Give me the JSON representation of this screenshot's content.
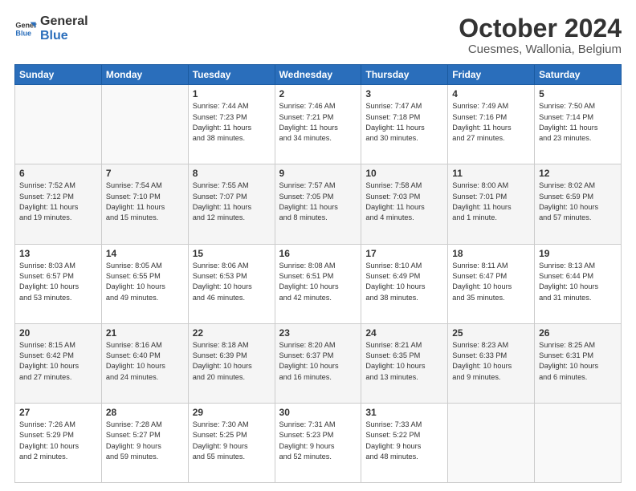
{
  "logo": {
    "line1": "General",
    "line2": "Blue"
  },
  "title": "October 2024",
  "location": "Cuesmes, Wallonia, Belgium",
  "days_of_week": [
    "Sunday",
    "Monday",
    "Tuesday",
    "Wednesday",
    "Thursday",
    "Friday",
    "Saturday"
  ],
  "weeks": [
    {
      "row_class": "row-odd",
      "days": [
        {
          "num": "",
          "detail": "",
          "empty": true
        },
        {
          "num": "",
          "detail": "",
          "empty": true
        },
        {
          "num": "1",
          "detail": "Sunrise: 7:44 AM\nSunset: 7:23 PM\nDaylight: 11 hours\nand 38 minutes.",
          "empty": false
        },
        {
          "num": "2",
          "detail": "Sunrise: 7:46 AM\nSunset: 7:21 PM\nDaylight: 11 hours\nand 34 minutes.",
          "empty": false
        },
        {
          "num": "3",
          "detail": "Sunrise: 7:47 AM\nSunset: 7:18 PM\nDaylight: 11 hours\nand 30 minutes.",
          "empty": false
        },
        {
          "num": "4",
          "detail": "Sunrise: 7:49 AM\nSunset: 7:16 PM\nDaylight: 11 hours\nand 27 minutes.",
          "empty": false
        },
        {
          "num": "5",
          "detail": "Sunrise: 7:50 AM\nSunset: 7:14 PM\nDaylight: 11 hours\nand 23 minutes.",
          "empty": false
        }
      ]
    },
    {
      "row_class": "row-even",
      "days": [
        {
          "num": "6",
          "detail": "Sunrise: 7:52 AM\nSunset: 7:12 PM\nDaylight: 11 hours\nand 19 minutes.",
          "empty": false
        },
        {
          "num": "7",
          "detail": "Sunrise: 7:54 AM\nSunset: 7:10 PM\nDaylight: 11 hours\nand 15 minutes.",
          "empty": false
        },
        {
          "num": "8",
          "detail": "Sunrise: 7:55 AM\nSunset: 7:07 PM\nDaylight: 11 hours\nand 12 minutes.",
          "empty": false
        },
        {
          "num": "9",
          "detail": "Sunrise: 7:57 AM\nSunset: 7:05 PM\nDaylight: 11 hours\nand 8 minutes.",
          "empty": false
        },
        {
          "num": "10",
          "detail": "Sunrise: 7:58 AM\nSunset: 7:03 PM\nDaylight: 11 hours\nand 4 minutes.",
          "empty": false
        },
        {
          "num": "11",
          "detail": "Sunrise: 8:00 AM\nSunset: 7:01 PM\nDaylight: 11 hours\nand 1 minute.",
          "empty": false
        },
        {
          "num": "12",
          "detail": "Sunrise: 8:02 AM\nSunset: 6:59 PM\nDaylight: 10 hours\nand 57 minutes.",
          "empty": false
        }
      ]
    },
    {
      "row_class": "row-odd",
      "days": [
        {
          "num": "13",
          "detail": "Sunrise: 8:03 AM\nSunset: 6:57 PM\nDaylight: 10 hours\nand 53 minutes.",
          "empty": false
        },
        {
          "num": "14",
          "detail": "Sunrise: 8:05 AM\nSunset: 6:55 PM\nDaylight: 10 hours\nand 49 minutes.",
          "empty": false
        },
        {
          "num": "15",
          "detail": "Sunrise: 8:06 AM\nSunset: 6:53 PM\nDaylight: 10 hours\nand 46 minutes.",
          "empty": false
        },
        {
          "num": "16",
          "detail": "Sunrise: 8:08 AM\nSunset: 6:51 PM\nDaylight: 10 hours\nand 42 minutes.",
          "empty": false
        },
        {
          "num": "17",
          "detail": "Sunrise: 8:10 AM\nSunset: 6:49 PM\nDaylight: 10 hours\nand 38 minutes.",
          "empty": false
        },
        {
          "num": "18",
          "detail": "Sunrise: 8:11 AM\nSunset: 6:47 PM\nDaylight: 10 hours\nand 35 minutes.",
          "empty": false
        },
        {
          "num": "19",
          "detail": "Sunrise: 8:13 AM\nSunset: 6:44 PM\nDaylight: 10 hours\nand 31 minutes.",
          "empty": false
        }
      ]
    },
    {
      "row_class": "row-even",
      "days": [
        {
          "num": "20",
          "detail": "Sunrise: 8:15 AM\nSunset: 6:42 PM\nDaylight: 10 hours\nand 27 minutes.",
          "empty": false
        },
        {
          "num": "21",
          "detail": "Sunrise: 8:16 AM\nSunset: 6:40 PM\nDaylight: 10 hours\nand 24 minutes.",
          "empty": false
        },
        {
          "num": "22",
          "detail": "Sunrise: 8:18 AM\nSunset: 6:39 PM\nDaylight: 10 hours\nand 20 minutes.",
          "empty": false
        },
        {
          "num": "23",
          "detail": "Sunrise: 8:20 AM\nSunset: 6:37 PM\nDaylight: 10 hours\nand 16 minutes.",
          "empty": false
        },
        {
          "num": "24",
          "detail": "Sunrise: 8:21 AM\nSunset: 6:35 PM\nDaylight: 10 hours\nand 13 minutes.",
          "empty": false
        },
        {
          "num": "25",
          "detail": "Sunrise: 8:23 AM\nSunset: 6:33 PM\nDaylight: 10 hours\nand 9 minutes.",
          "empty": false
        },
        {
          "num": "26",
          "detail": "Sunrise: 8:25 AM\nSunset: 6:31 PM\nDaylight: 10 hours\nand 6 minutes.",
          "empty": false
        }
      ]
    },
    {
      "row_class": "row-odd",
      "days": [
        {
          "num": "27",
          "detail": "Sunrise: 7:26 AM\nSunset: 5:29 PM\nDaylight: 10 hours\nand 2 minutes.",
          "empty": false
        },
        {
          "num": "28",
          "detail": "Sunrise: 7:28 AM\nSunset: 5:27 PM\nDaylight: 9 hours\nand 59 minutes.",
          "empty": false
        },
        {
          "num": "29",
          "detail": "Sunrise: 7:30 AM\nSunset: 5:25 PM\nDaylight: 9 hours\nand 55 minutes.",
          "empty": false
        },
        {
          "num": "30",
          "detail": "Sunrise: 7:31 AM\nSunset: 5:23 PM\nDaylight: 9 hours\nand 52 minutes.",
          "empty": false
        },
        {
          "num": "31",
          "detail": "Sunrise: 7:33 AM\nSunset: 5:22 PM\nDaylight: 9 hours\nand 48 minutes.",
          "empty": false
        },
        {
          "num": "",
          "detail": "",
          "empty": true
        },
        {
          "num": "",
          "detail": "",
          "empty": true
        }
      ]
    }
  ]
}
